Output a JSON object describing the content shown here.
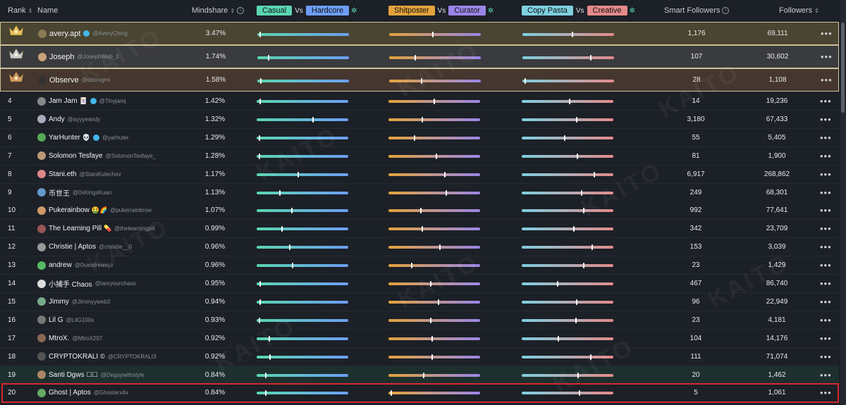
{
  "watermark": "KAITO",
  "columns": {
    "rank": "Rank",
    "name": "Name",
    "mindshare": "Mindshare",
    "pair1": {
      "left": "Casual",
      "vs": "Vs",
      "right": "Hardcore"
    },
    "pair2": {
      "left": "Shitposter",
      "vs": "Vs",
      "right": "Curator"
    },
    "pair3": {
      "left": "Copy Pasta",
      "vs": "Vs",
      "right": "Creative"
    },
    "smart_followers": "Smart Followers",
    "followers": "Followers"
  },
  "colors": {
    "casual": "#5ad6b0",
    "hardcore": "#6d9ef5",
    "shitposter": "#e3a33c",
    "curator": "#9a86e8",
    "copy_pasta": "#7ecfe0",
    "creative": "#e48a8a",
    "gold_border": "#cfc29a",
    "highlight_red": "#d7272f"
  },
  "rows": [
    {
      "rank": "1",
      "crown": "gold",
      "name": "avery.apt",
      "handle": "@AveryChing",
      "verified": true,
      "emoji": "",
      "mindshare": "3.47%",
      "p1": 0.02,
      "p2": 0.48,
      "p3": 0.55,
      "smart": "1,176",
      "followers": "69,111",
      "bg": "#4a4532"
    },
    {
      "rank": "2",
      "crown": "silver",
      "name": "Joseph",
      "handle": "@JosephWeb_3",
      "verified": false,
      "emoji": "",
      "mindshare": "1.74%",
      "p1": 0.12,
      "p2": 0.28,
      "p3": 0.75,
      "smart": "107",
      "followers": "30,602",
      "bg": "#3a3b3e"
    },
    {
      "rank": "3",
      "crown": "bronze",
      "name": "Observe",
      "handle": "@obsrvgmi",
      "verified": false,
      "emoji": "",
      "mindshare": "1.58%",
      "p1": 0.03,
      "p2": 0.35,
      "p3": 0.02,
      "smart": "28",
      "followers": "1,108",
      "bg": "#45372f"
    },
    {
      "rank": "4",
      "crown": "",
      "name": "Jam Jam",
      "handle": "@Tinyjamj",
      "verified": true,
      "emoji": "🃏",
      "mindshare": "1.42%",
      "p1": 0.03,
      "p2": 0.5,
      "p3": 0.52,
      "smart": "14",
      "followers": "19,236",
      "bg": "#1c2027"
    },
    {
      "rank": "5",
      "crown": "",
      "name": "Andy",
      "handle": "@ayyyeandy",
      "verified": false,
      "emoji": "",
      "mindshare": "1.32%",
      "p1": 0.62,
      "p2": 0.37,
      "p3": 0.6,
      "smart": "3,180",
      "followers": "67,433",
      "bg": "#1c2027"
    },
    {
      "rank": "6",
      "crown": "",
      "name": "YarHunter",
      "handle": "@yarhuter",
      "verified": true,
      "emoji": "💀",
      "mindshare": "1.29%",
      "p1": 0.02,
      "p2": 0.28,
      "p3": 0.47,
      "smart": "55",
      "followers": "5,405",
      "bg": "#1c2027"
    },
    {
      "rank": "7",
      "crown": "",
      "name": "Solomon Tesfaye",
      "handle": "@SolomonTesfaye_",
      "verified": false,
      "emoji": "",
      "mindshare": "1.28%",
      "p1": 0.02,
      "p2": 0.52,
      "p3": 0.61,
      "smart": "81",
      "followers": "1,900",
      "bg": "#1c2027"
    },
    {
      "rank": "8",
      "crown": "",
      "name": "Stani.eth",
      "handle": "@StaniKulechov",
      "verified": false,
      "emoji": "",
      "mindshare": "1.17%",
      "p1": 0.45,
      "p2": 0.62,
      "p3": 0.8,
      "smart": "6,917",
      "followers": "268,862",
      "bg": "#1c2027"
    },
    {
      "rank": "9",
      "crown": "",
      "name": "币世王",
      "handle": "@0xKingsKuan",
      "verified": false,
      "emoji": "",
      "mindshare": "1.13%",
      "p1": 0.25,
      "p2": 0.63,
      "p3": 0.66,
      "smart": "249",
      "followers": "68,301",
      "bg": "#1c2027"
    },
    {
      "rank": "10",
      "crown": "",
      "name": "Pukerainbow",
      "handle": "@pukerrainbrow",
      "verified": false,
      "emoji": "🤮🌈",
      "mindshare": "1.07%",
      "p1": 0.38,
      "p2": 0.35,
      "p3": 0.68,
      "smart": "992",
      "followers": "77,641",
      "bg": "#1c2027"
    },
    {
      "rank": "11",
      "crown": "",
      "name": "The Learning Pill",
      "handle": "@thelearningpill",
      "verified": false,
      "emoji": "💊",
      "mindshare": "0.99%",
      "p1": 0.27,
      "p2": 0.37,
      "p3": 0.57,
      "smart": "342",
      "followers": "23,709",
      "bg": "#1c2027"
    },
    {
      "rank": "12",
      "crown": "",
      "name": "Christie | Aptos",
      "handle": "@christie__0",
      "verified": false,
      "emoji": "",
      "mindshare": "0.96%",
      "p1": 0.36,
      "p2": 0.56,
      "p3": 0.77,
      "smart": "153",
      "followers": "3,039",
      "bg": "#1c2027"
    },
    {
      "rank": "13",
      "crown": "",
      "name": "andrew",
      "handle": "@0xandrewxyz",
      "verified": false,
      "emoji": "",
      "mindshare": "0.96%",
      "p1": 0.39,
      "p2": 0.25,
      "p3": 0.68,
      "smart": "23",
      "followers": "1,429",
      "bg": "#1c2027"
    },
    {
      "rank": "14",
      "crown": "",
      "name": "小捕手 Chaos",
      "handle": "@iamyourchaos",
      "verified": false,
      "emoji": "",
      "mindshare": "0.95%",
      "p1": 0.03,
      "p2": 0.46,
      "p3": 0.39,
      "smart": "467",
      "followers": "86,740",
      "bg": "#1c2027"
    },
    {
      "rank": "15",
      "crown": "",
      "name": "Jimmy",
      "handle": "@Jimmyyweb3",
      "verified": false,
      "emoji": "",
      "mindshare": "0.94%",
      "p1": 0.03,
      "p2": 0.55,
      "p3": 0.6,
      "smart": "96",
      "followers": "22,949",
      "bg": "#1c2027"
    },
    {
      "rank": "16",
      "crown": "",
      "name": "Lil G",
      "handle": "@LilG100x",
      "verified": false,
      "emoji": "",
      "mindshare": "0.93%",
      "p1": 0.02,
      "p2": 0.46,
      "p3": 0.59,
      "smart": "23",
      "followers": "4,181",
      "bg": "#1c2027"
    },
    {
      "rank": "17",
      "crown": "",
      "name": "MtroX.",
      "handle": "@MtroX207",
      "verified": false,
      "emoji": "",
      "mindshare": "0.92%",
      "p1": 0.13,
      "p2": 0.48,
      "p3": 0.4,
      "smart": "104",
      "followers": "14,176",
      "bg": "#1c2027"
    },
    {
      "rank": "18",
      "crown": "",
      "name": "CRYPTOKRALI",
      "handle": "@CRYPTOKRALI3",
      "verified": false,
      "emoji": "©",
      "mindshare": "0.92%",
      "p1": 0.14,
      "p2": 0.48,
      "p3": 0.76,
      "smart": "111",
      "followers": "71,074",
      "bg": "#1c2027"
    },
    {
      "rank": "19",
      "crown": "",
      "name": "Santi Dgws",
      "handle": "@Deguywithstyle",
      "verified": false,
      "emoji": "☐☐",
      "mindshare": "0.84%",
      "p1": 0.09,
      "p2": 0.38,
      "p3": 0.62,
      "smart": "20",
      "followers": "1,462",
      "bg": "#1d302e"
    },
    {
      "rank": "20",
      "crown": "",
      "name": "Ghost | Aptos",
      "handle": "@Ghosterx4x",
      "verified": false,
      "emoji": "",
      "mindshare": "0.84%",
      "p1": 0.09,
      "p2": 0.02,
      "p3": 0.63,
      "smart": "5",
      "followers": "1,061",
      "bg": "#1c2027"
    }
  ]
}
